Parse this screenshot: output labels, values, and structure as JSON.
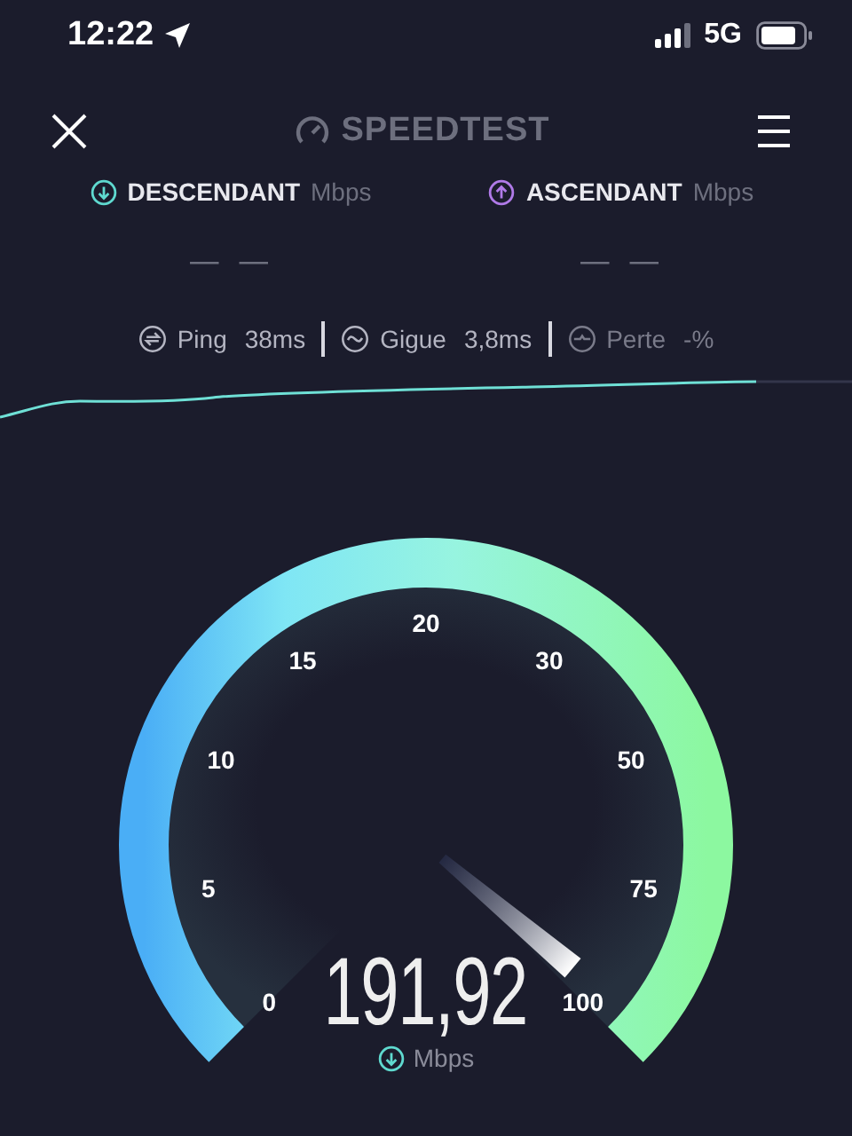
{
  "status_bar": {
    "time": "12:22",
    "network": "5G"
  },
  "header": {
    "logo": "SPEEDTEST"
  },
  "results": [
    {
      "kind": "download",
      "label": "DESCENDANT",
      "unit": "Mbps",
      "value": "— —",
      "color": "#5fd9cf"
    },
    {
      "kind": "upload",
      "label": "ASCENDANT",
      "unit": "Mbps",
      "value": "— —",
      "color": "#b07ae8"
    }
  ],
  "metrics": [
    {
      "kind": "ping",
      "label": "Ping",
      "value": "38ms",
      "dimmed": false
    },
    {
      "kind": "jitter",
      "label": "Gigue",
      "value": "3,8ms",
      "dimmed": false
    },
    {
      "kind": "loss",
      "label": "Perte",
      "value": "-%",
      "dimmed": true
    }
  ],
  "gauge": {
    "ticks": [
      "0",
      "5",
      "10",
      "15",
      "20",
      "30",
      "50",
      "75",
      "100"
    ],
    "reading": "191,92",
    "unit": "Mbps"
  }
}
